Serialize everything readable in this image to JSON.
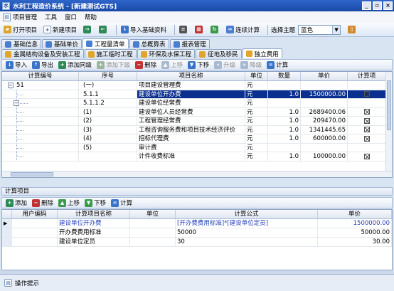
{
  "window": {
    "title": "水利工程造价系统 - [新建测试GTS]",
    "app_icon": "app-icon"
  },
  "menu": {
    "items": [
      "项目管理",
      "工具",
      "窗口",
      "帮助"
    ]
  },
  "toolbar": {
    "open_project": "打开项目",
    "new_project": "新建项目",
    "import_base": "导入基础资料",
    "continuous_calc": "连续计算",
    "theme_label": "选择主题",
    "theme_value": "蓝色"
  },
  "tabs_row1": [
    "基础信息",
    "基础单价",
    "工程量清单",
    "总概算表",
    "报表管理"
  ],
  "tabs_row1_active": 2,
  "tabs_row2": [
    "金属结构设备及安装工程",
    "施工临时工程",
    "环保及水保工程",
    "征地及移民",
    "独立费用"
  ],
  "tabs_row2_active": 4,
  "sub_toolbar": {
    "import": "导入",
    "export": "导出",
    "add_same": "添加同级",
    "add_child": "添加下级",
    "delete": "删除",
    "move_up": "上移",
    "move_down": "下移",
    "promote": "升级",
    "demote": "降级",
    "calculate": "计算"
  },
  "main_grid": {
    "columns": [
      "计算编号",
      "序号",
      "项目名称",
      "单位",
      "数量",
      "单价",
      "计算项"
    ],
    "rows": [
      {
        "code": "51",
        "seq": "(一)",
        "name": "项目建设管理费",
        "unit": "元",
        "qty": "",
        "price": "",
        "calc": false,
        "selected": false
      },
      {
        "code": "",
        "seq": "5.1.1",
        "name": "建设单位开办费",
        "unit": "元",
        "qty": "1.0",
        "price": "1500000.00",
        "calc": true,
        "selected": true
      },
      {
        "code": "",
        "seq": "5.1.1.2",
        "name": "建设单位经常费",
        "unit": "元",
        "qty": "",
        "price": "",
        "calc": false,
        "selected": false
      },
      {
        "code": "",
        "seq": "(1)",
        "name": "建设单位人员经常费",
        "unit": "元",
        "qty": "1.0",
        "price": "2689400.06",
        "calc": true,
        "selected": false
      },
      {
        "code": "",
        "seq": "(2)",
        "name": "工程管理经常费",
        "unit": "元",
        "qty": "1.0",
        "price": "209470.00",
        "calc": true,
        "selected": false
      },
      {
        "code": "",
        "seq": "(3)",
        "name": "工程咨询服务费和项目技术经济评价",
        "unit": "元",
        "qty": "1.0",
        "price": "1341445.65",
        "calc": true,
        "selected": false
      },
      {
        "code": "",
        "seq": "(4)",
        "name": "招标代理费",
        "unit": "元",
        "qty": "1.0",
        "price": "600000.00",
        "calc": true,
        "selected": false
      },
      {
        "code": "",
        "seq": "(5)",
        "name": "审计费",
        "unit": "元",
        "qty": "",
        "price": "",
        "calc": false,
        "selected": false
      },
      {
        "code": "",
        "seq": "",
        "name": "计件收费标准",
        "unit": "元",
        "qty": "1.0",
        "price": "100000.00",
        "calc": true,
        "selected": false
      }
    ]
  },
  "calc_panel": {
    "title": "计算项目",
    "toolbar": {
      "add": "添加",
      "delete": "删除",
      "up": "上移",
      "down": "下移",
      "calc": "计算"
    },
    "columns": [
      "用户编码",
      "计算项目名称",
      "单位",
      "计算公式",
      "单价"
    ],
    "rows": [
      {
        "name": "建设单位开办费",
        "unit": "",
        "formula": "[开办费费用标准]*[建设单位定员]",
        "price": "1500000.00",
        "highlight": true
      },
      {
        "name": "开办费费用标准",
        "unit": "",
        "formula": "50000",
        "price": "50000.00",
        "highlight": false
      },
      {
        "name": "建设单位定员",
        "unit": "",
        "formula": "30",
        "price": "30.00",
        "highlight": false
      }
    ]
  },
  "status": {
    "label": "操作提示"
  },
  "colors": {
    "title_bar": "#1a49a8",
    "selection": "#0b2f8f",
    "link_text": "#1f3fb8"
  }
}
